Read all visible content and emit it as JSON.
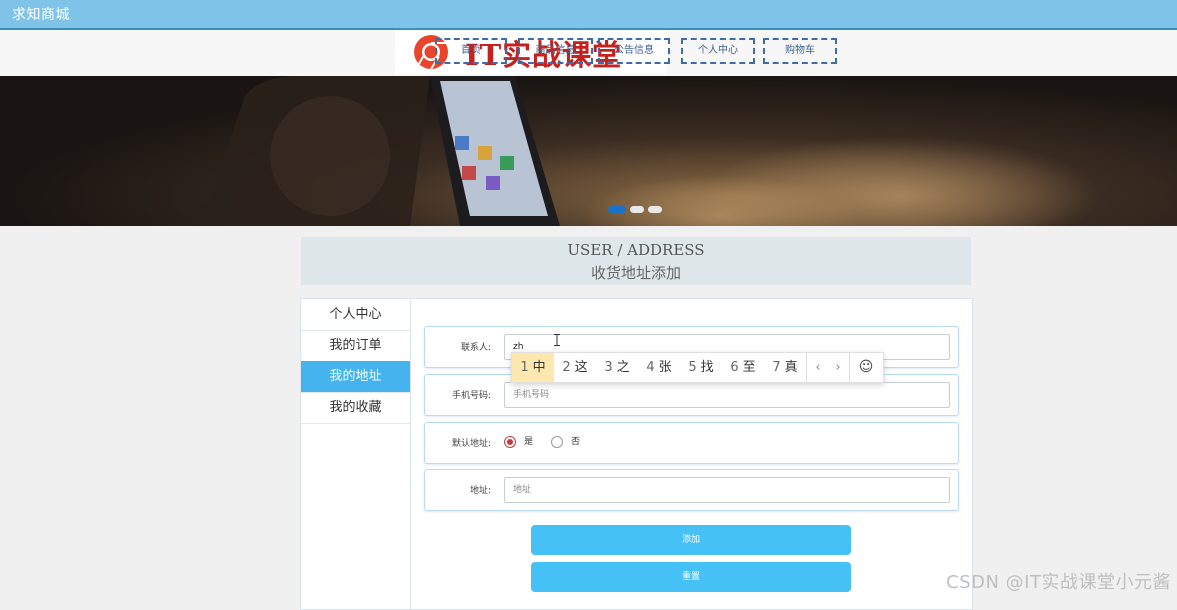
{
  "header": {
    "site_name": "求知商城",
    "logo_text": "IT实战课堂",
    "nav": [
      "首页",
      "商品信息",
      "公告信息",
      "个人中心",
      "购物车"
    ]
  },
  "banner": {
    "slides": 3,
    "active_slide": 1
  },
  "section": {
    "title_en": "USER / ADDRESS",
    "title_cn": "收货地址添加"
  },
  "sidebar": {
    "items": [
      {
        "label": "个人中心"
      },
      {
        "label": "我的订单"
      },
      {
        "label": "我的地址",
        "active": true
      },
      {
        "label": "我的收藏"
      }
    ]
  },
  "form": {
    "contact": {
      "label": "联系人:",
      "value": "zh"
    },
    "phone": {
      "label": "手机号码:",
      "placeholder": "手机号码"
    },
    "default_address": {
      "label": "默认地址:",
      "options": [
        "是",
        "否"
      ],
      "selected": "是"
    },
    "address": {
      "label": "地址:",
      "placeholder": "地址"
    },
    "add_button": "添加",
    "reset_button": "重置"
  },
  "ime": {
    "candidates": [
      {
        "num": "1",
        "text": "中"
      },
      {
        "num": "2",
        "text": "这"
      },
      {
        "num": "3",
        "text": "之"
      },
      {
        "num": "4",
        "text": "张"
      },
      {
        "num": "5",
        "text": "找"
      },
      {
        "num": "6",
        "text": "至"
      },
      {
        "num": "7",
        "text": "真"
      }
    ],
    "emoji_glyph": "☺"
  },
  "watermark": "CSDN @IT实战课堂小元酱",
  "colors": {
    "accent": "#45b4ee",
    "button": "#45c1f5",
    "topbar": "#7fc3e8",
    "logo": "#c8201c"
  }
}
